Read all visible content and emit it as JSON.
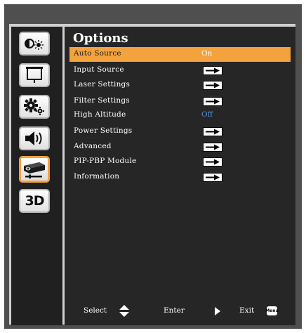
{
  "sidebar": {
    "items": [
      {
        "icon": "brightness-contrast-icon"
      },
      {
        "icon": "screen-icon"
      },
      {
        "icon": "gear-settings-icon"
      },
      {
        "icon": "speaker-volume-icon"
      },
      {
        "icon": "projector-options-icon",
        "active": true
      },
      {
        "icon": "3d-icon",
        "label": "3D"
      }
    ]
  },
  "main": {
    "title": "Options",
    "items": [
      {
        "label": "Auto Source",
        "value": "On",
        "selected": true
      },
      {
        "label": "Input Source",
        "submenu": true
      },
      {
        "label": "Laser Settings",
        "submenu": true
      },
      {
        "label": "Filter Settings",
        "submenu": true
      },
      {
        "label": "High Altitude",
        "value": "Off"
      },
      {
        "label": "Power Settings",
        "submenu": true
      },
      {
        "label": "Advanced",
        "submenu": true
      },
      {
        "label": "PIP-PBP Module",
        "submenu": true
      },
      {
        "label": "Information",
        "submenu": true
      }
    ]
  },
  "footer": {
    "select_label": "Select",
    "enter_label": "Enter",
    "exit_label": "Exit",
    "menu_key_label": "Menu"
  },
  "colors": {
    "accent": "#f3a23d",
    "value_text": "#4f8fd6",
    "panel_bg": "#262626",
    "sidebar_bg": "#202020"
  }
}
